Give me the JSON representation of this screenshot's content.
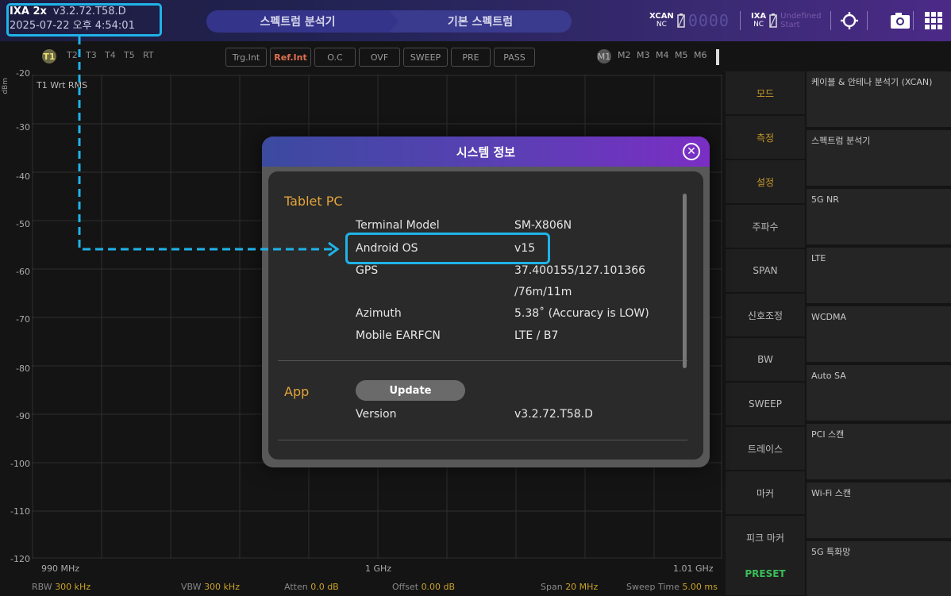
{
  "header": {
    "model": "IXA 2x",
    "version": "v3.2.72.T58.D",
    "datetime": "2025-07-22 오후 4:54:01",
    "tabs": [
      "스펙트럼 분석기",
      "기본 스펙트럼"
    ],
    "xcan_status": {
      "label": "XCAN",
      "sub": "NC",
      "digits": "0000"
    },
    "ixa_status": {
      "label": "IXA",
      "sub": "NC",
      "small1": "Undefined",
      "small2": "Start"
    }
  },
  "traces": [
    "T1",
    "T2",
    "T3",
    "T4",
    "T5",
    "RT"
  ],
  "indicators": [
    "Trg.Int",
    "Ref.Int",
    "O.C",
    "OVF",
    "SWEEP",
    "PRE",
    "PASS"
  ],
  "markers": [
    "M1",
    "M2",
    "M3",
    "M4",
    "M5",
    "M6"
  ],
  "plot": {
    "unit": "dBm",
    "trace_label": "T1 Wrt RMS",
    "y_ticks": [
      "-20",
      "-30",
      "-40",
      "-50",
      "-60",
      "-70",
      "-80",
      "-90",
      "-100",
      "-110",
      "-120"
    ],
    "x_start": "990 MHz",
    "x_center": "1 GHz",
    "x_stop": "1.01 GHz"
  },
  "params": [
    {
      "label": "RBW",
      "value": "300 kHz"
    },
    {
      "label": "VBW",
      "value": "300 kHz"
    },
    {
      "label": "Atten",
      "value": "0.0 dB"
    },
    {
      "label": "Offset",
      "value": "0.00 dB"
    },
    {
      "label": "Span",
      "value": "20 MHz"
    },
    {
      "label": "Sweep Time",
      "value": "5.00 ms"
    }
  ],
  "menu_left": [
    "모드",
    "측정",
    "설정",
    "주파수",
    "SPAN",
    "신호조정",
    "BW",
    "SWEEP",
    "트레이스",
    "마커",
    "피크 마커",
    "PRESET"
  ],
  "menu_right": [
    "케이블 & 안테나 분석기 (XCAN)",
    "스펙트럼 분석기",
    "5G NR",
    "LTE",
    "WCDMA",
    "Auto SA",
    "PCI 스캔",
    "Wi-Fi 스캔",
    "5G 특화망"
  ],
  "dialog": {
    "title": "시스템 정보",
    "tablet_section": "Tablet PC",
    "rows": [
      {
        "label": "Terminal Model",
        "value": "SM-X806N"
      },
      {
        "label": "Android OS",
        "value": "v15"
      },
      {
        "label": "GPS",
        "value": "37.400155/127.101366"
      },
      {
        "label": "",
        "value": "/76m/11m"
      },
      {
        "label": "Azimuth",
        "value": "5.38˚ (Accuracy is LOW)"
      },
      {
        "label": "Mobile EARFCN",
        "value": "LTE / B7"
      }
    ],
    "app_section": "App",
    "update_label": "Update",
    "version_label": "Version",
    "version_value": "v3.2.72.T58.D"
  },
  "colors": {
    "accent": "#1fb3e8",
    "section": "#e3a53a",
    "param_value": "#c9a227",
    "preset": "#3bbd5a"
  }
}
